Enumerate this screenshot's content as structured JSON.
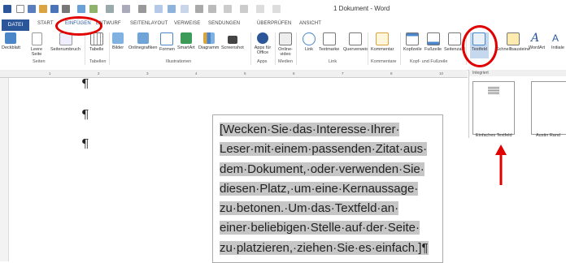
{
  "window": {
    "title": "1 Dokument - Word"
  },
  "tabs": [
    "DATEI",
    "START",
    "EINFÜGEN",
    "ENTWURF",
    "SEITENLAYOUT",
    "VERWEISE",
    "SENDUNGEN",
    "ÜBERPRÜFEN",
    "ANSICHT"
  ],
  "ribbon": {
    "buttons": [
      {
        "label": "Deckblatt",
        "icon": "cover-page-icon"
      },
      {
        "label": "Leere Seite",
        "icon": "blank-page-icon"
      },
      {
        "label": "Seitenumbruch",
        "icon": "page-break-icon"
      },
      {
        "label": "Tabelle",
        "icon": "table-icon"
      },
      {
        "label": "Bilder",
        "icon": "pictures-icon"
      },
      {
        "label": "Onlinegrafiken",
        "icon": "online-pictures-icon"
      },
      {
        "label": "Formen",
        "icon": "shapes-icon"
      },
      {
        "label": "SmartArt",
        "icon": "smartart-icon"
      },
      {
        "label": "Diagramm",
        "icon": "chart-icon"
      },
      {
        "label": "Screenshot",
        "icon": "screenshot-icon"
      },
      {
        "label": "Apps für Office",
        "icon": "apps-icon"
      },
      {
        "label": "Online-video",
        "icon": "online-video-icon"
      },
      {
        "label": "Link",
        "icon": "link-icon"
      },
      {
        "label": "Textmarke",
        "icon": "bookmark-icon"
      },
      {
        "label": "Querverweis",
        "icon": "cross-reference-icon"
      },
      {
        "label": "Kommentar",
        "icon": "comment-icon"
      },
      {
        "label": "Kopfzeile",
        "icon": "header-icon"
      },
      {
        "label": "Fußzeile",
        "icon": "footer-icon"
      },
      {
        "label": "Seitenzahl",
        "icon": "page-number-icon"
      },
      {
        "label": "Textfeld",
        "icon": "textbox-icon"
      },
      {
        "label": "Schnellbausteine",
        "icon": "quick-parts-icon"
      },
      {
        "label": "WordArt",
        "icon": "wordart-icon"
      },
      {
        "label": "Initiale",
        "icon": "drop-cap-icon"
      }
    ],
    "groups": [
      "Seiten",
      "Tabellen",
      "Illustrationen",
      "Apps",
      "Medien",
      "Link",
      "Kommentare",
      "Kopf- und Fußzeile"
    ]
  },
  "gallery": {
    "header": "Integriert",
    "items": [
      "Einfaches Textfeld",
      "Austin Rand"
    ]
  },
  "document": {
    "pilcrow": "¶",
    "textbox_lines": [
      "[Wecken·Sie·das·Interesse·Ihrer·",
      "Leser·mit·einem·passenden·Zitat·aus·",
      "dem·Dokument,·oder·verwenden·Sie·",
      "diesen·Platz,·um·eine·Kernaussage·",
      "zu·betonen.·Um·das·Textfeld·an·",
      "einer·beliebigen·Stelle·auf·der·Seite·",
      "zu·platzieren,·ziehen·Sie·es·einfach.]¶"
    ]
  },
  "colors": {
    "accent": "#2b579a",
    "annotation": "#e00000",
    "highlight": "#c6c6c6"
  }
}
